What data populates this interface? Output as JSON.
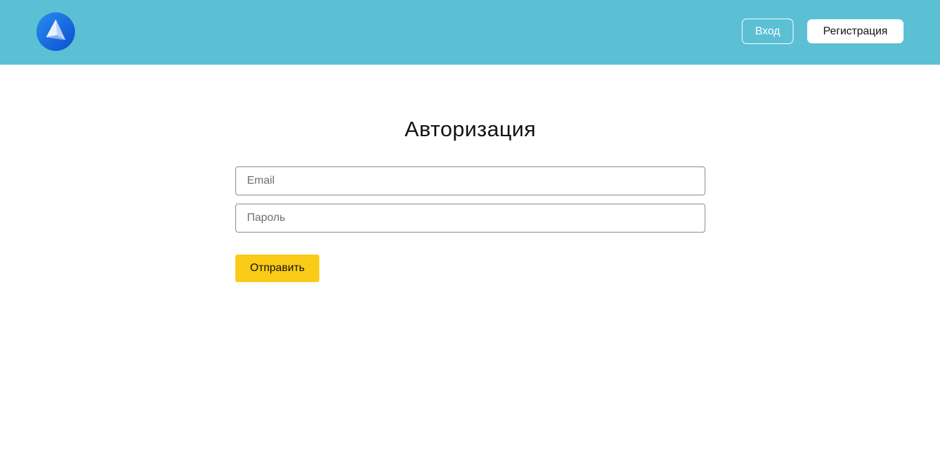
{
  "header": {
    "logo_icon": "paper-sail-logo-icon",
    "background_color": "#5bc0d4",
    "login_label": "Вход",
    "register_label": "Регистрация"
  },
  "auth_form": {
    "title": "Авторизация",
    "email_placeholder": "Email",
    "password_placeholder": "Пароль",
    "submit_label": "Отправить",
    "submit_color": "#facb17"
  }
}
